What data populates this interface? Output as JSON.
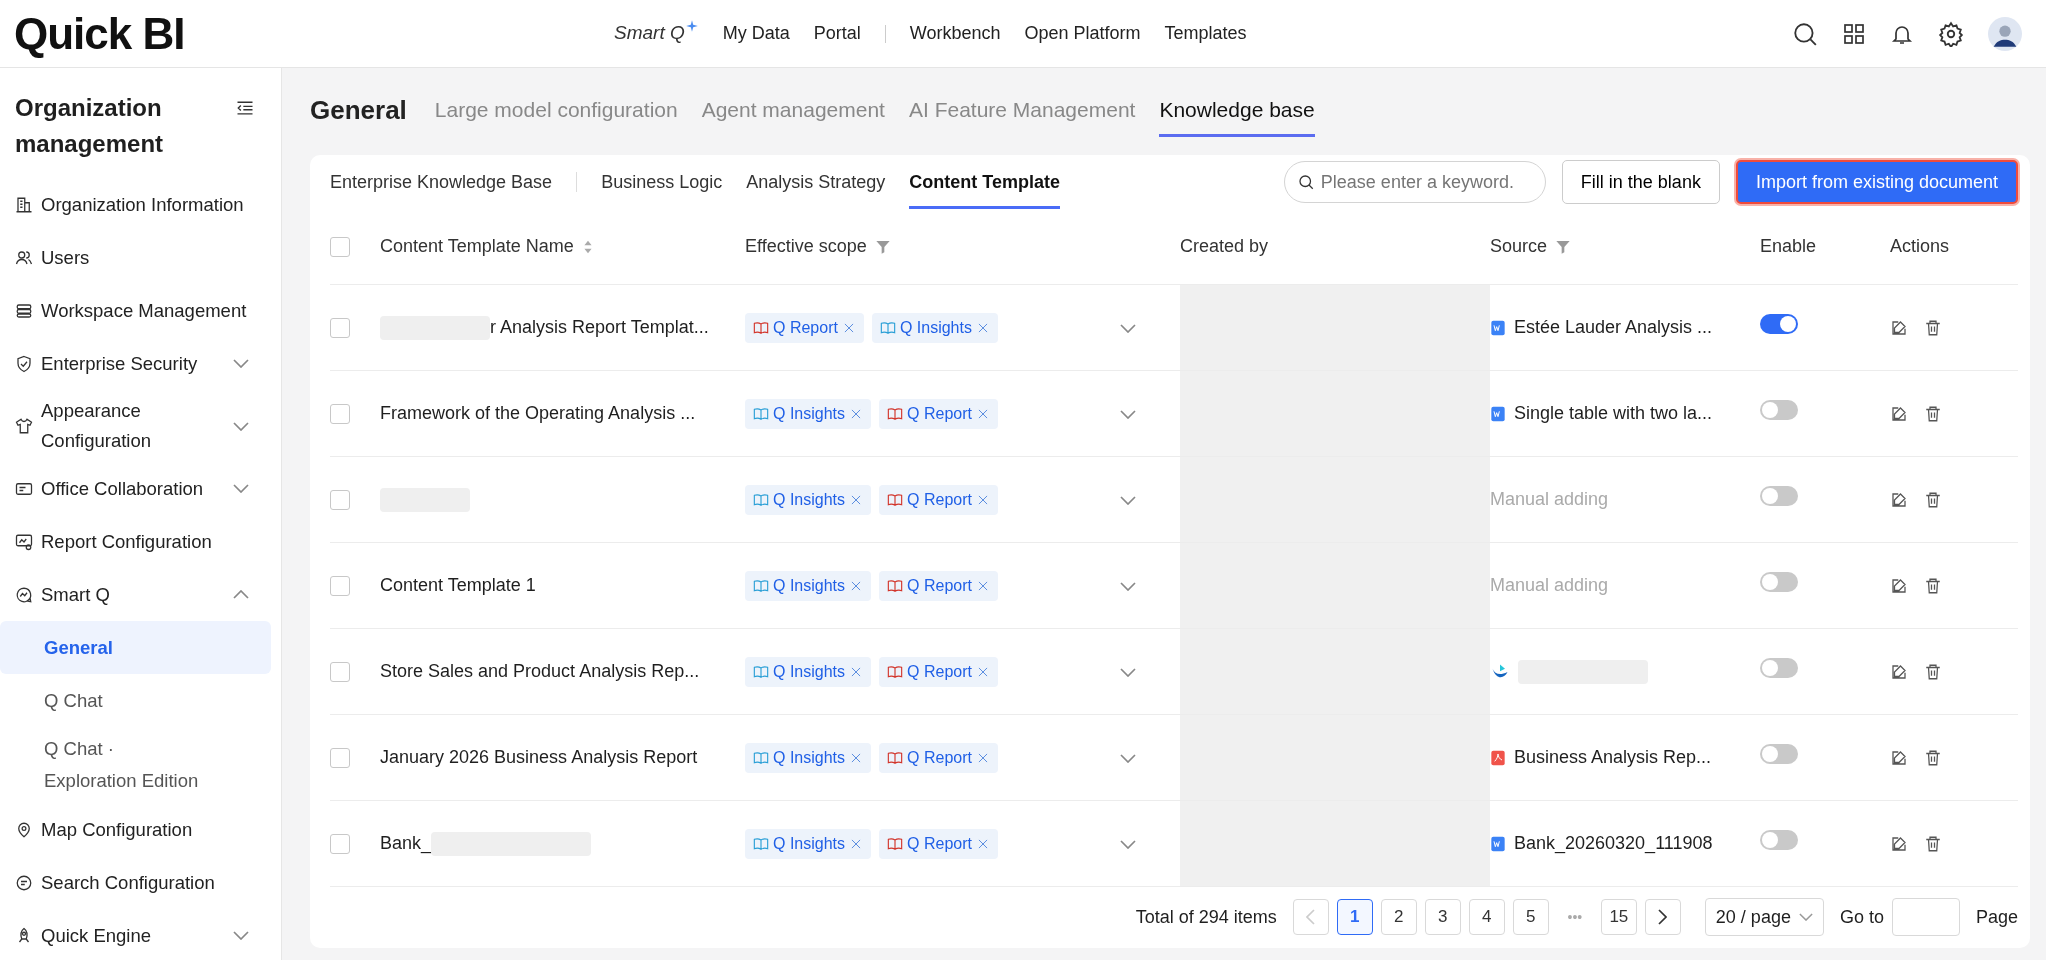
{
  "topbar": {
    "logo": "Quick BI",
    "smart_q": "Smart Q",
    "menu": [
      {
        "label": "My Data",
        "divider_after": false
      },
      {
        "label": "Portal",
        "divider_after": true
      },
      {
        "label": "Workbench",
        "divider_after": false
      },
      {
        "label": "Open Platform",
        "divider_after": false
      },
      {
        "label": "Templates",
        "divider_after": false
      }
    ]
  },
  "sidebar": {
    "title": "Organization management",
    "items": [
      {
        "label": "Organization Information",
        "expandable": false
      },
      {
        "label": "Users",
        "expandable": false
      },
      {
        "label": "Workspace Management",
        "expandable": false
      },
      {
        "label": "Enterprise Security",
        "expandable": true,
        "expanded": false
      },
      {
        "label": "Appearance Configuration",
        "expandable": true,
        "expanded": false
      },
      {
        "label": "Office Collaboration",
        "expandable": true,
        "expanded": false
      },
      {
        "label": "Report Configuration",
        "expandable": false
      },
      {
        "label": "Smart Q",
        "expandable": true,
        "expanded": true,
        "children": [
          {
            "label": "General",
            "selected": true
          },
          {
            "label": "Q Chat",
            "selected": false
          },
          {
            "label": "Q Chat · Exploration Edition",
            "selected": false
          }
        ]
      },
      {
        "label": "Map Configuration",
        "expandable": false
      },
      {
        "label": "Search Configuration",
        "expandable": false
      },
      {
        "label": "Quick Engine",
        "expandable": true,
        "expanded": false
      }
    ]
  },
  "tabs": [
    {
      "label": "General",
      "selected": false,
      "kind": "title"
    },
    {
      "label": "Large model configuration",
      "selected": false,
      "kind": "tab"
    },
    {
      "label": "Agent management",
      "selected": false,
      "kind": "tab"
    },
    {
      "label": "AI Feature Management",
      "selected": false,
      "kind": "tab"
    },
    {
      "label": "Knowledge base",
      "selected": true,
      "kind": "tab"
    }
  ],
  "subtabs": [
    {
      "label": "Enterprise Knowledge Base",
      "selected": false
    },
    {
      "label": "Business Logic",
      "selected": false
    },
    {
      "label": "Analysis Strategy",
      "selected": false
    },
    {
      "label": "Content Template",
      "selected": true
    }
  ],
  "search": {
    "placeholder": "Please enter a keyword."
  },
  "buttons": [
    {
      "label": "Fill in the blank",
      "kind": "default"
    },
    {
      "label": "Import from existing document",
      "kind": "primary"
    }
  ],
  "table": {
    "all_checked": false,
    "columns": [
      {
        "label": "Content Template Name",
        "sortable": true,
        "filterable": false
      },
      {
        "label": "Effective scope",
        "sortable": false,
        "filterable": true
      },
      {
        "label": "Created by",
        "sortable": false,
        "filterable": false
      },
      {
        "label": "Source",
        "sortable": false,
        "filterable": true
      },
      {
        "label": "Enable",
        "sortable": false,
        "filterable": false
      },
      {
        "label": "Actions",
        "sortable": false,
        "filterable": false
      }
    ],
    "rows": [
      {
        "kind": "prefixhidden",
        "checked": false,
        "name": "r Analysis Report Templat...",
        "scopes": [
          {
            "label": "Q Report",
            "kind": "report"
          },
          {
            "label": "Q Insights",
            "kind": "insights"
          }
        ],
        "source": {
          "kind": "doc",
          "text": "Estée Lauder Analysis ..."
        },
        "enabled": true
      },
      {
        "kind": "plain",
        "checked": false,
        "name": "Framework of the Operating Analysis ...",
        "scopes": [
          {
            "label": "Q Insights",
            "kind": "insights"
          },
          {
            "label": "Q Report",
            "kind": "report"
          }
        ],
        "source": {
          "kind": "doc",
          "text": "Single table with two la..."
        },
        "enabled": false
      },
      {
        "kind": "hidden",
        "checked": false,
        "scopes": [
          {
            "label": "Q Insights",
            "kind": "insights"
          },
          {
            "label": "Q Report",
            "kind": "report"
          }
        ],
        "source": {
          "kind": "manual",
          "text": "Manual adding"
        },
        "enabled": false
      },
      {
        "kind": "plain",
        "checked": false,
        "name": "Content Template 1",
        "scopes": [
          {
            "label": "Q Insights",
            "kind": "insights"
          },
          {
            "label": "Q Report",
            "kind": "report"
          }
        ],
        "source": {
          "kind": "manual",
          "text": "Manual adding"
        },
        "enabled": false
      },
      {
        "kind": "plain",
        "checked": false,
        "name": "Store Sales and Product Analysis Rep...",
        "scopes": [
          {
            "label": "Q Insights",
            "kind": "insights"
          },
          {
            "label": "Q Report",
            "kind": "report"
          }
        ],
        "source": {
          "kind": "app"
        },
        "enabled": false
      },
      {
        "kind": "plain",
        "checked": false,
        "name": "January 2026 Business Analysis Report",
        "scopes": [
          {
            "label": "Q Insights",
            "kind": "insights"
          },
          {
            "label": "Q Report",
            "kind": "report"
          }
        ],
        "source": {
          "kind": "pdf",
          "text": "Business Analysis Rep..."
        },
        "enabled": false
      },
      {
        "kind": "suffixhidden",
        "checked": false,
        "name": "Bank_",
        "scopes": [
          {
            "label": "Q Insights",
            "kind": "insights"
          },
          {
            "label": "Q Report",
            "kind": "report"
          }
        ],
        "source": {
          "kind": "doc",
          "text": "Bank_20260320_111908"
        },
        "enabled": false
      }
    ]
  },
  "pagination": {
    "total": "Total of 294 items",
    "pages": [
      {
        "label": "1",
        "selected": true,
        "kind": "page"
      },
      {
        "label": "2",
        "selected": false,
        "kind": "page"
      },
      {
        "label": "3",
        "selected": false,
        "kind": "page"
      },
      {
        "label": "4",
        "selected": false,
        "kind": "page"
      },
      {
        "label": "5",
        "selected": false,
        "kind": "page"
      },
      {
        "label": "•••",
        "selected": false,
        "kind": "ellipsis"
      },
      {
        "label": "15",
        "selected": false,
        "kind": "page"
      }
    ],
    "page_size": "20 / page",
    "goto": "Go to",
    "page_label": "Page"
  }
}
